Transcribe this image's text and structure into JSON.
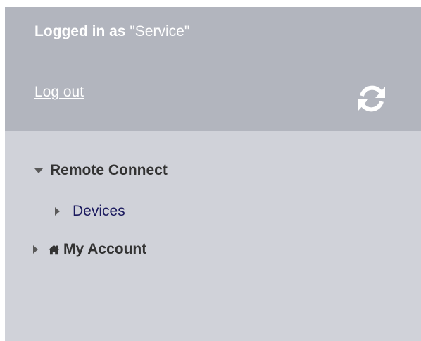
{
  "header": {
    "login_prefix": "Logged in as ",
    "login_user": "\"Service\"",
    "logout_label": "Log out",
    "refresh_icon": "refresh-icon"
  },
  "nav": {
    "items": [
      {
        "label": "Remote Connect",
        "expanded": true,
        "icon": "caret-down-icon"
      },
      {
        "label": "Devices",
        "expanded": false,
        "icon": "caret-right-icon"
      },
      {
        "label": "My Account",
        "expanded": false,
        "icon": "home-icon"
      }
    ]
  },
  "colors": {
    "header_bg": "#b2b5be",
    "nav_bg": "#d0d2d9",
    "link_color": "#1b1a5e",
    "text_dark": "#333333"
  }
}
